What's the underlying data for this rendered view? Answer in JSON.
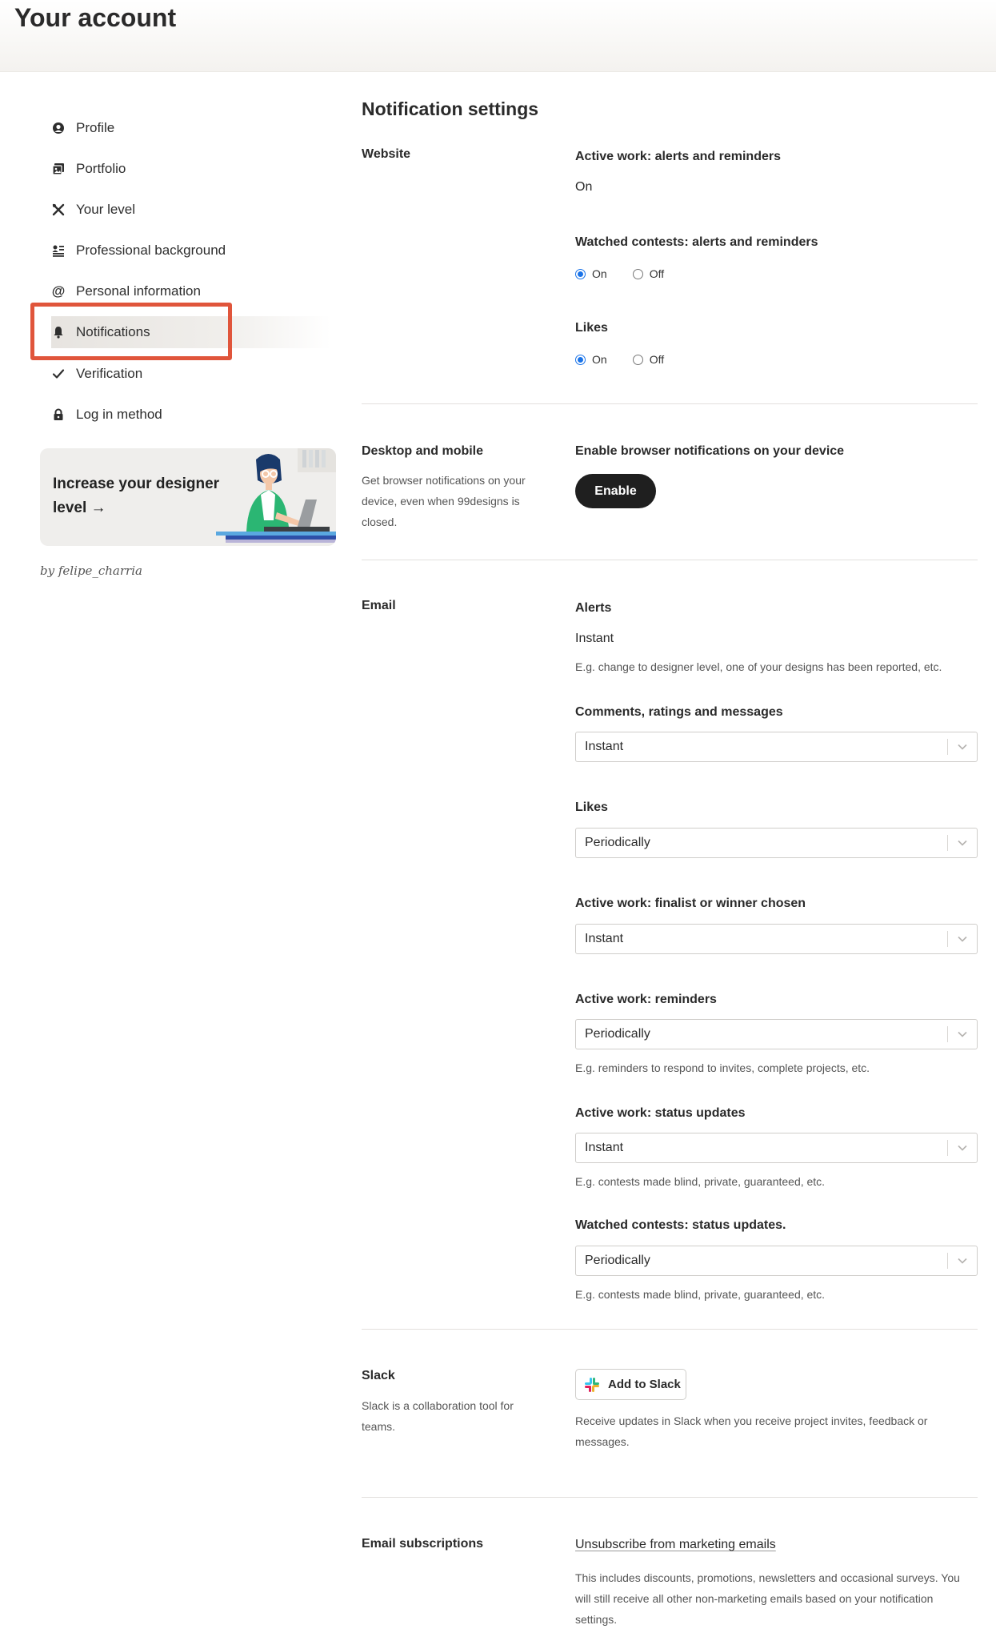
{
  "header": {
    "title": "Your account"
  },
  "sidebar": {
    "items": [
      {
        "label": "Profile",
        "icon": "profile-icon"
      },
      {
        "label": "Portfolio",
        "icon": "portfolio-icon"
      },
      {
        "label": "Your level",
        "icon": "level-icon"
      },
      {
        "label": "Professional background",
        "icon": "background-icon"
      },
      {
        "label": "Personal information",
        "icon": "at-sign-icon"
      },
      {
        "label": "Notifications",
        "icon": "bell-icon"
      },
      {
        "label": "Verification",
        "icon": "checkmark-icon"
      },
      {
        "label": "Log in method",
        "icon": "lock-icon"
      }
    ],
    "promo": {
      "text": "Increase your designer level →"
    },
    "credit": "by felipe_charria"
  },
  "main": {
    "title": "Notification settings",
    "website": {
      "label": "Website",
      "active_work_label": "Active work: alerts and reminders",
      "active_work_value": "On",
      "watched_label": "Watched contests: alerts and reminders",
      "likes_label": "Likes",
      "on_label": "On",
      "off_label": "Off"
    },
    "desktop": {
      "label": "Desktop and mobile",
      "description": "Get browser notifications on your device, even when 99designs is closed.",
      "field_label": "Enable browser notifications on your device",
      "button": "Enable"
    },
    "email": {
      "label": "Email",
      "alerts_label": "Alerts",
      "alerts_value": "Instant",
      "alerts_hint": "E.g. change to designer level, one of your designs has been reported, etc.",
      "comments_label": "Comments, ratings and messages",
      "comments_value": "Instant",
      "likes_label": "Likes",
      "likes_value": "Periodically",
      "finalist_label": "Active work: finalist or winner chosen",
      "finalist_value": "Instant",
      "reminders_label": "Active work: reminders",
      "reminders_value": "Periodically",
      "reminders_hint": "E.g. reminders to respond to invites, complete projects, etc.",
      "status_label": "Active work: status updates",
      "status_value": "Instant",
      "status_hint": "E.g. contests made blind, private, guaranteed, etc.",
      "watched_label": "Watched contests: status updates.",
      "watched_value": "Periodically",
      "watched_hint": "E.g. contests made blind, private, guaranteed, etc."
    },
    "slack": {
      "label": "Slack",
      "description": "Slack is a collaboration tool for teams.",
      "button": "Add to Slack",
      "info": "Receive updates in Slack when you receive project invites, feedback or messages."
    },
    "subscriptions": {
      "label": "Email subscriptions",
      "link": "Unsubscribe from marketing emails",
      "description": "This includes discounts, promotions, newsletters and occasional surveys. You will still receive all other non-marketing emails based on your notification settings."
    }
  },
  "colors": {
    "accent_highlight": "#e0553b",
    "radio_blue": "#1a73e8",
    "button_dark": "#1f1f1f"
  }
}
